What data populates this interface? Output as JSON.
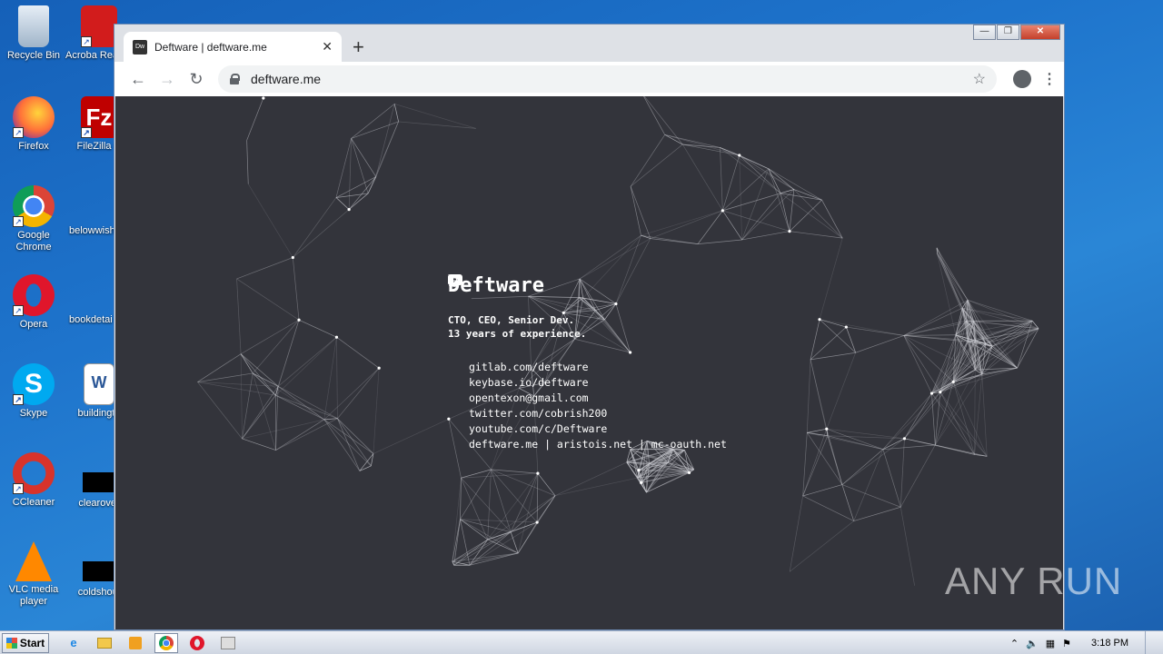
{
  "desktop": {
    "icons_left": [
      {
        "label": "Recycle Bin",
        "icon": "recycle-bin-icon"
      },
      {
        "label": "Firefox",
        "icon": "firefox-icon"
      },
      {
        "label": "Google Chrome",
        "icon": "chrome-icon"
      },
      {
        "label": "Opera",
        "icon": "opera-icon"
      },
      {
        "label": "Skype",
        "icon": "skype-icon"
      },
      {
        "label": "CCleaner",
        "icon": "ccleaner-icon"
      },
      {
        "label": "VLC media player",
        "icon": "vlc-icon"
      }
    ],
    "icons_right": [
      {
        "label": "Acroba Reader",
        "icon": "acrobat-icon"
      },
      {
        "label": "FileZilla C",
        "icon": "filezilla-icon"
      },
      {
        "label": "belowwish",
        "icon": "file-icon"
      },
      {
        "label": "bookdetai",
        "icon": "file-icon"
      },
      {
        "label": "buildingtir",
        "icon": "word-doc-icon"
      },
      {
        "label": "clearover",
        "icon": "file-icon"
      },
      {
        "label": "coldshoul",
        "icon": "file-icon"
      }
    ]
  },
  "browser": {
    "tab": {
      "favicon": "Dw",
      "title": "Deftware | deftware.me",
      "close": "✕"
    },
    "new_tab": "+",
    "url": "deftware.me",
    "window_controls": {
      "minimize": "—",
      "maximize": "❐",
      "close": "✕"
    }
  },
  "page": {
    "heading": "Deftware",
    "intro_line1": "CTO, CEO, Senior Dev.",
    "intro_line2": "13 years of experience.",
    "links": [
      {
        "icon": "github-icon",
        "text": "gitlab.com/deftware"
      },
      {
        "icon": "key-icon",
        "text": "keybase.io/deftware"
      },
      {
        "icon": "mail-icon",
        "text": "opentexon@gmail.com"
      },
      {
        "icon": "twitter-icon",
        "text": "twitter.com/cobrish200"
      },
      {
        "icon": "youtube-icon",
        "text": "youtube.com/c/Deftware"
      },
      {
        "icon": "globe-icon",
        "text": "deftware.me | aristois.net | mc-oauth.net"
      }
    ]
  },
  "taskbar": {
    "start_label": "Start",
    "clock": "3:18 PM"
  },
  "watermark": "ANY RUN",
  "colors": {
    "page_bg": "#33343b",
    "desktop_blue": "#1e74cc",
    "accent_close": "#c4402b"
  }
}
